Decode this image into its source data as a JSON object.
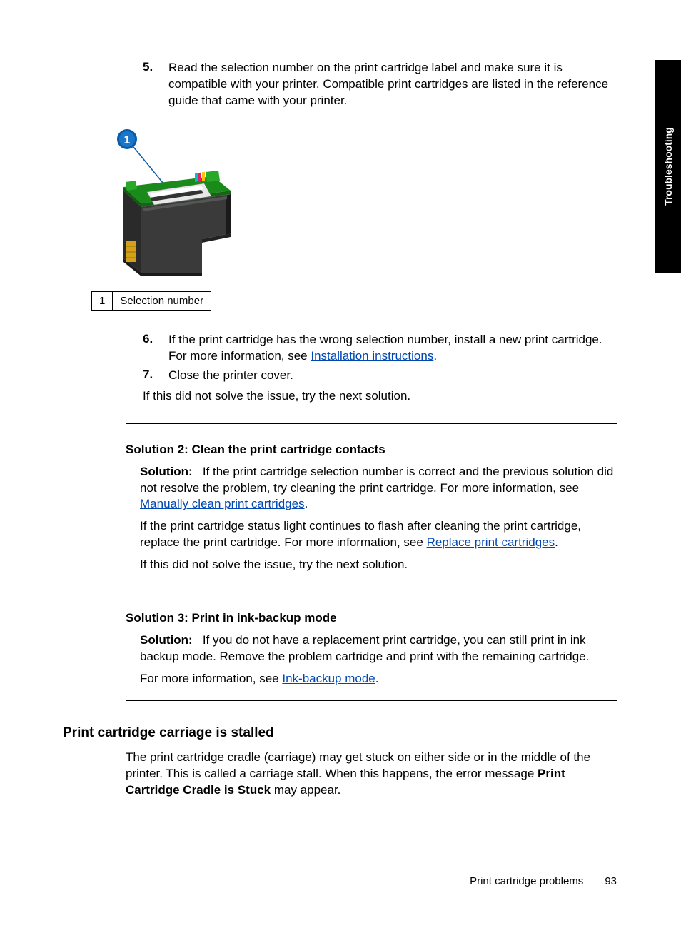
{
  "sideTab": "Troubleshooting",
  "steps": {
    "s5": {
      "num": "5.",
      "text": "Read the selection number on the print cartridge label and make sure it is compatible with your printer. Compatible print cartridges are listed in the reference guide that came with your printer."
    },
    "s6": {
      "num": "6.",
      "text_a": "If the print cartridge has the wrong selection number, install a new print cartridge. For more information, see ",
      "link": "Installation instructions",
      "text_b": "."
    },
    "s7": {
      "num": "7.",
      "text": "Close the printer cover."
    }
  },
  "callout": {
    "num": "1",
    "label": "Selection number"
  },
  "afterSteps": "If this did not solve the issue, try the next solution.",
  "sol2": {
    "title": "Solution 2: Clean the print cartridge contacts",
    "lead": "Solution:",
    "p1a": "If the print cartridge selection number is correct and the previous solution did not resolve the problem, try cleaning the print cartridge. For more information, see ",
    "p1link": "Manually clean print cartridges",
    "p1b": ".",
    "p2a": "If the print cartridge status light continues to flash after cleaning the print cartridge, replace the print cartridge. For more information, see ",
    "p2link": "Replace print cartridges",
    "p2b": ".",
    "p3": "If this did not solve the issue, try the next solution."
  },
  "sol3": {
    "title": "Solution 3: Print in ink-backup mode",
    "lead": "Solution:",
    "p1": "If you do not have a replacement print cartridge, you can still print in ink backup mode. Remove the problem cartridge and print with the remaining cartridge.",
    "p2a": "For more information, see ",
    "p2link": "Ink-backup mode",
    "p2b": "."
  },
  "section": {
    "title": "Print cartridge carriage is stalled",
    "p_a": "The print cartridge cradle (carriage) may get stuck on either side or in the middle of the printer. This is called a carriage stall. When this happens, the error message ",
    "p_bold": "Print Cartridge Cradle is Stuck",
    "p_b": " may appear."
  },
  "footer": {
    "section": "Print cartridge problems",
    "page": "93"
  },
  "calloutBubble": "1"
}
